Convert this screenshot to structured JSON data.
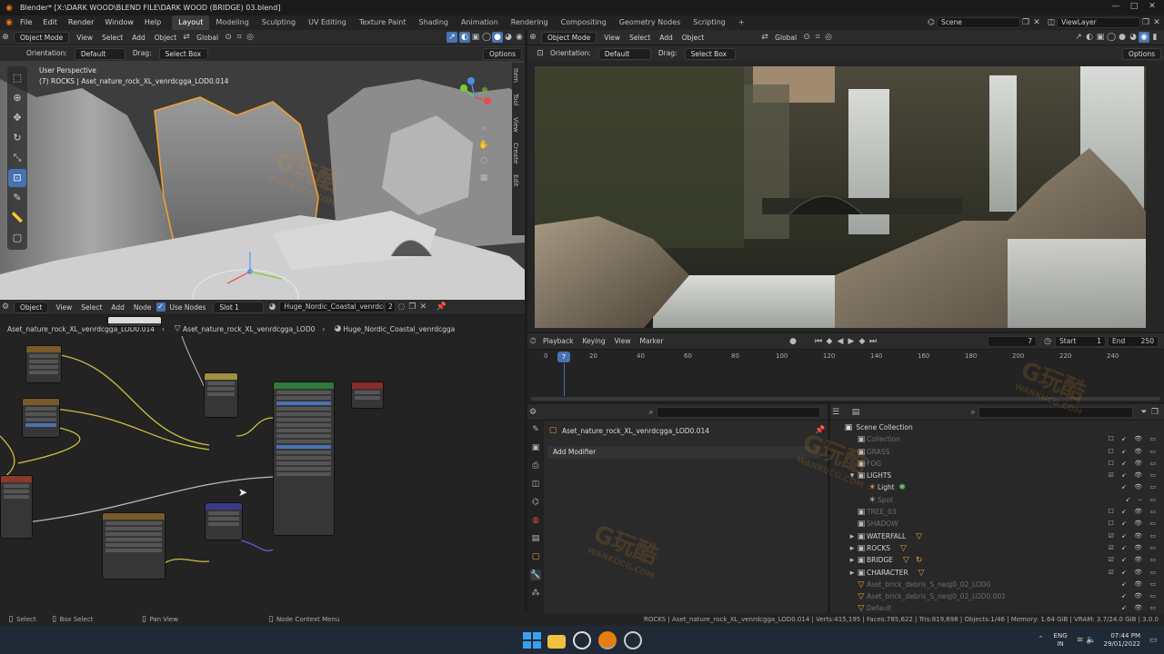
{
  "window": {
    "title": "Blender* [X:\\DARK WOOD\\BLEND FILE\\DARK WOOD (BRIDGE) 03.blend]",
    "controls": [
      "—",
      "□",
      "✕"
    ]
  },
  "menubar": {
    "items": [
      "File",
      "Edit",
      "Render",
      "Window",
      "Help"
    ],
    "workspaces": [
      "Layout",
      "Modeling",
      "Sculpting",
      "UV Editing",
      "Texture Paint",
      "Shading",
      "Animation",
      "Rendering",
      "Compositing",
      "Geometry Nodes",
      "Scripting"
    ],
    "active_workspace": "Layout",
    "add_workspace": "+",
    "scene": "Scene",
    "view_layer": "ViewLayer"
  },
  "viewport_left": {
    "mode": "Object Mode",
    "menus": [
      "View",
      "Select",
      "Add",
      "Object"
    ],
    "transform": "Global",
    "orientation_label": "Orientation:",
    "orientation_value": "Default",
    "drag_label": "Drag:",
    "drag_value": "Select Box",
    "options": "Options",
    "perspective": "User Perspective",
    "active_object": "(7) ROCKS | Aset_nature_rock_XL_venrdcgga_LOD0.014",
    "side_tabs": [
      "Item",
      "Tool",
      "View",
      "Create",
      "Edit"
    ]
  },
  "viewport_right": {
    "mode": "Object Mode",
    "menus": [
      "View",
      "Select",
      "Add",
      "Object"
    ],
    "transform": "Global",
    "orientation_label": "Orientation:",
    "orientation_value": "Default",
    "drag_label": "Drag:",
    "drag_value": "Select Box",
    "options": "Options"
  },
  "node_editor": {
    "type": "Object",
    "menus": [
      "View",
      "Select",
      "Add",
      "Node"
    ],
    "use_nodes": "Use Nodes",
    "slot": "Slot 1",
    "material": "Huge_Nordic_Coastal_venrdcgga",
    "user_count": "2",
    "breadcrumb": [
      "Aset_nature_rock_XL_venrdcgga_LOD0.014",
      "Aset_nature_rock_XL_venrdcgga_LOD0",
      "Huge_Nordic_Coastal_venrdcgga"
    ]
  },
  "timeline": {
    "menus": [
      "Playback",
      "Keying",
      "View",
      "Marker"
    ],
    "current_frame": "7",
    "start_label": "Start",
    "start": "1",
    "end_label": "End",
    "end": "250",
    "ticks": [
      "0",
      "20",
      "40",
      "60",
      "80",
      "100",
      "120",
      "140",
      "160",
      "180",
      "200",
      "220",
      "240"
    ],
    "playhead": "7"
  },
  "properties": {
    "object_name": "Aset_nature_rock_XL_venrdcgga_LOD0.014",
    "add_modifier": "Add Modifier"
  },
  "outliner": {
    "header": "Scene Collection",
    "rows": [
      {
        "label": "Collection",
        "dim": true
      },
      {
        "label": "GRASS",
        "dim": true
      },
      {
        "label": "FOG",
        "dim": true
      },
      {
        "label": "LIGHTS",
        "dim": false
      },
      {
        "label": "Light",
        "dim": false
      },
      {
        "label": "Spot",
        "dim": true
      },
      {
        "label": "TREE_03",
        "dim": true
      },
      {
        "label": "SHADOW",
        "dim": true
      },
      {
        "label": "WATERFALL",
        "dim": false
      },
      {
        "label": "ROCKS",
        "dim": false
      },
      {
        "label": "BRIDGE",
        "dim": false
      },
      {
        "label": "CHARACTER",
        "dim": false
      },
      {
        "label": "Aset_brick_debris_S_neqj0_02_LOD0",
        "dim": true
      },
      {
        "label": "Aset_brick_debris_S_neqj0_02_LOD0.001",
        "dim": true
      },
      {
        "label": "Default",
        "dim": true
      }
    ]
  },
  "statusbar": {
    "hints": [
      "Select",
      "Box Select",
      "Pan View",
      "Node Context Menu"
    ],
    "stats": "ROCKS | Aset_nature_rock_XL_venrdcgga_LOD0.014 | Verts:415,195 | Faces:785,622 | Tris:819,698 | Objects:1/46 | Memory: 1.64 GiB | VRAM: 3.7/24.0 GiB | 3.0.0"
  },
  "taskbar": {
    "lang": "ENG",
    "region": "IN",
    "time": "07:44 PM",
    "date": "29/01/2022"
  },
  "watermark": {
    "text": "G玩酷",
    "sub": "WANKUCG.COM"
  },
  "colors": {
    "accent": "#4772b3",
    "selection_orange": "#f0a030",
    "collection_orange": "#e8a040"
  }
}
